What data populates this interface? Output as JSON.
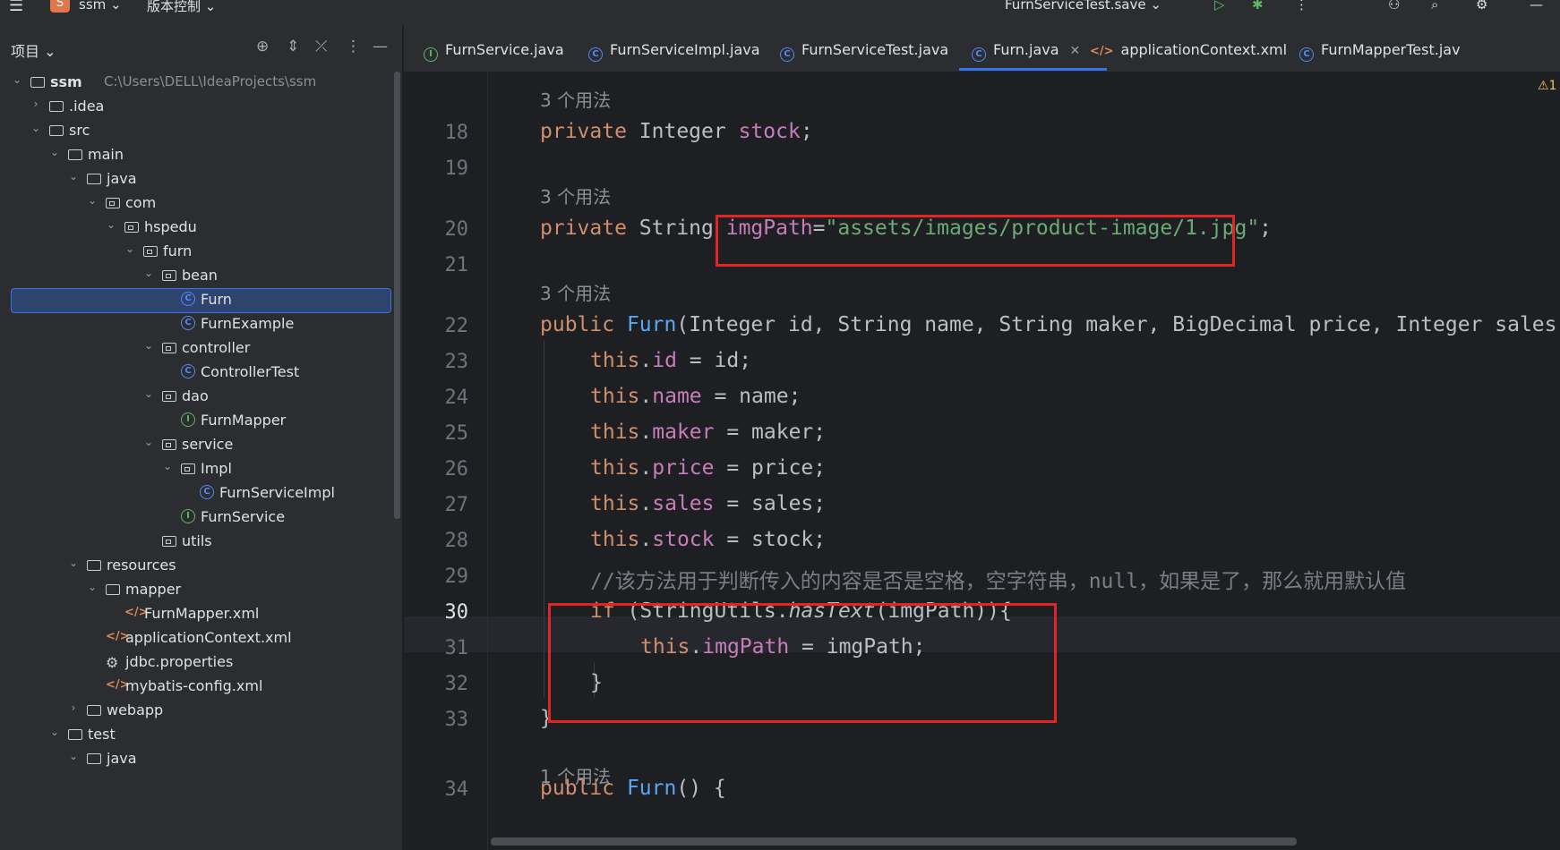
{
  "titlebar": {
    "project_badge": "S",
    "project_name": "ssm",
    "vcs_label": "版本控制",
    "run_config": "FurnServiceTest.save"
  },
  "sidebar": {
    "title": "项目",
    "tree": [
      {
        "label": "ssm",
        "path": "C:\\Users\\DELL\\IdeaProjects\\ssm",
        "type": "module",
        "depth": 0,
        "chevron": "down"
      },
      {
        "label": ".idea",
        "type": "folder",
        "depth": 1,
        "chevron": "right"
      },
      {
        "label": "src",
        "type": "folder",
        "depth": 1,
        "chevron": "down"
      },
      {
        "label": "main",
        "type": "folder",
        "depth": 2,
        "chevron": "down"
      },
      {
        "label": "java",
        "type": "folder-src",
        "depth": 3,
        "chevron": "down"
      },
      {
        "label": "com",
        "type": "package",
        "depth": 4,
        "chevron": "down"
      },
      {
        "label": "hspedu",
        "type": "package",
        "depth": 5,
        "chevron": "down"
      },
      {
        "label": "furn",
        "type": "package",
        "depth": 6,
        "chevron": "down"
      },
      {
        "label": "bean",
        "type": "package",
        "depth": 7,
        "chevron": "down"
      },
      {
        "label": "Furn",
        "type": "class",
        "depth": 8,
        "chevron": "",
        "selected": true
      },
      {
        "label": "FurnExample",
        "type": "class",
        "depth": 8,
        "chevron": ""
      },
      {
        "label": "controller",
        "type": "package",
        "depth": 7,
        "chevron": "down"
      },
      {
        "label": "ControllerTest",
        "type": "class",
        "depth": 8,
        "chevron": ""
      },
      {
        "label": "dao",
        "type": "package",
        "depth": 7,
        "chevron": "down"
      },
      {
        "label": "FurnMapper",
        "type": "interface",
        "depth": 8,
        "chevron": ""
      },
      {
        "label": "service",
        "type": "package",
        "depth": 7,
        "chevron": "down"
      },
      {
        "label": "Impl",
        "type": "package",
        "depth": 8,
        "chevron": "down"
      },
      {
        "label": "FurnServiceImpl",
        "type": "class",
        "depth": 9,
        "chevron": ""
      },
      {
        "label": "FurnService",
        "type": "interface",
        "depth": 8,
        "chevron": ""
      },
      {
        "label": "utils",
        "type": "package",
        "depth": 7,
        "chevron": ""
      },
      {
        "label": "resources",
        "type": "folder-res",
        "depth": 3,
        "chevron": "down"
      },
      {
        "label": "mapper",
        "type": "folder",
        "depth": 4,
        "chevron": "down"
      },
      {
        "label": "FurnMapper.xml",
        "type": "xml",
        "depth": 5,
        "chevron": ""
      },
      {
        "label": "applicationContext.xml",
        "type": "xml",
        "depth": 4,
        "chevron": ""
      },
      {
        "label": "jdbc.properties",
        "type": "properties",
        "depth": 4,
        "chevron": ""
      },
      {
        "label": "mybatis-config.xml",
        "type": "xml",
        "depth": 4,
        "chevron": ""
      },
      {
        "label": "webapp",
        "type": "folder",
        "depth": 3,
        "chevron": "right"
      },
      {
        "label": "test",
        "type": "folder",
        "depth": 2,
        "chevron": "down"
      },
      {
        "label": "java",
        "type": "folder",
        "depth": 3,
        "chevron": "down"
      }
    ]
  },
  "tabs": [
    {
      "label": "FurnService.java",
      "icon": "interface"
    },
    {
      "label": "FurnServiceImpl.java",
      "icon": "class"
    },
    {
      "label": "FurnServiceTest.java",
      "icon": "class"
    },
    {
      "label": "Furn.java",
      "icon": "class",
      "active": true
    },
    {
      "label": "applicationContext.xml",
      "icon": "xml"
    },
    {
      "label": "FurnMapperTest.jav",
      "icon": "class"
    }
  ],
  "editor": {
    "warning_indicator": "⚠1",
    "usage_hints": [
      "3 个用法",
      "3 个用法",
      "3 个用法",
      "1 个用法"
    ],
    "lines": [
      {
        "n": "18",
        "text": "private Integer stock;"
      },
      {
        "n": "19",
        "text": ""
      },
      {
        "n": "20",
        "text": "private String imgPath=\"assets/images/product-image/1.jpg\";"
      },
      {
        "n": "21",
        "text": ""
      },
      {
        "n": "22",
        "text": "public Furn(Integer id, String name, String maker, BigDecimal price, Integer sales"
      },
      {
        "n": "23",
        "text": "this.id = id;"
      },
      {
        "n": "24",
        "text": "this.name = name;"
      },
      {
        "n": "25",
        "text": "this.maker = maker;"
      },
      {
        "n": "26",
        "text": "this.price = price;"
      },
      {
        "n": "27",
        "text": "this.sales = sales;"
      },
      {
        "n": "28",
        "text": "this.stock = stock;"
      },
      {
        "n": "29",
        "text": "//该方法用于判断传入的内容是否是空格，空字符串，null，如果是了，那么就用默认值"
      },
      {
        "n": "30",
        "text": "if (StringUtils.hasText(imgPath)){"
      },
      {
        "n": "31",
        "text": "this.imgPath = imgPath;"
      },
      {
        "n": "32",
        "text": "}"
      },
      {
        "n": "33",
        "text": "}"
      },
      {
        "n": "34",
        "text": "public Furn() {"
      }
    ],
    "current_line": "30",
    "highlight_color": "#e32424"
  }
}
